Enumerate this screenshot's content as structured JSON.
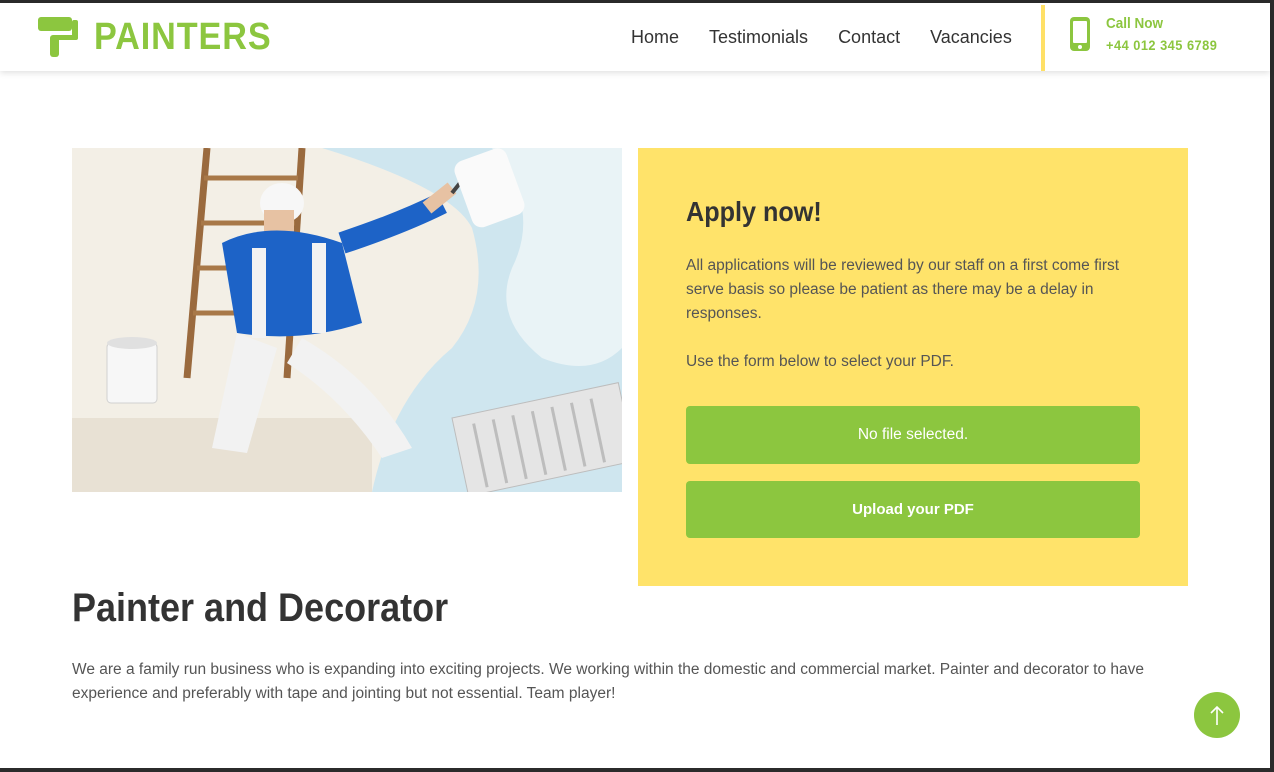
{
  "brand": {
    "name": "PAINTERS",
    "logo_icon": "paint-roller-icon",
    "accent_color": "#8cc63f",
    "highlight_color": "#ffe36a"
  },
  "nav": {
    "items": [
      {
        "label": "Home"
      },
      {
        "label": "Testimonials"
      },
      {
        "label": "Contact"
      },
      {
        "label": "Vacancies"
      }
    ]
  },
  "call": {
    "icon": "mobile-phone-icon",
    "label": "Call Now",
    "number": "+44 012 345 6789"
  },
  "apply": {
    "title": "Apply now!",
    "paragraph1": "All applications will be reviewed by our staff on a first come first serve basis so please be patient as there may be a delay in responses.",
    "paragraph2": "Use the form below to select your PDF.",
    "file_status": "No file selected.",
    "upload_label": "Upload your PDF"
  },
  "job": {
    "title": "Painter and Decorator",
    "description": "We are a family run business who is expanding into exciting projects. We working within the domestic and commercial market. Painter and decorator to have experience and preferably with tape and jointing but not essential. Team player!"
  },
  "back_to_top": {
    "icon": "arrow-up-icon"
  }
}
